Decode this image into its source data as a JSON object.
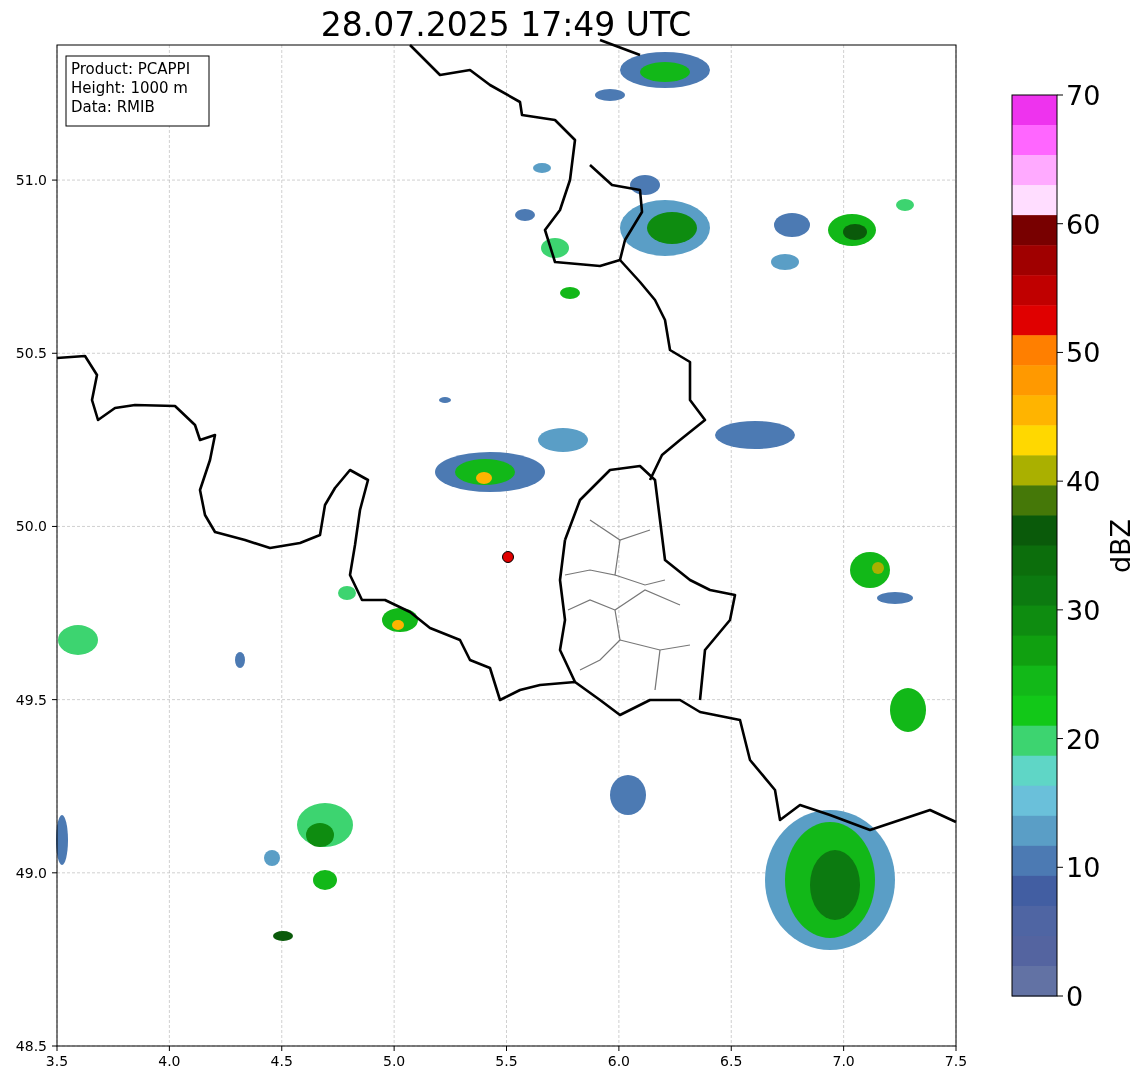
{
  "title": "28.07.2025 17:49 UTC",
  "info_box": [
    "Product: PCAPPI",
    "Height: 1000 m",
    "Data: RMIB"
  ],
  "map": {
    "xticks": [
      "3.5",
      "4.0",
      "4.5",
      "5.0",
      "5.5",
      "6.0",
      "6.5",
      "7.0",
      "7.5"
    ],
    "yticks": [
      "51.0",
      "50.5",
      "50.0",
      "49.5",
      "49.0",
      "48.5"
    ]
  },
  "colorbar": {
    "label": "dBZ",
    "ticks": [
      "70",
      "60",
      "50",
      "40",
      "30",
      "20",
      "10",
      "0"
    ],
    "bands": [
      {
        "color": "#ee33ee"
      },
      {
        "color": "#ff66ff"
      },
      {
        "color": "#ffaaff"
      },
      {
        "color": "#ffddff"
      },
      {
        "color": "#780000"
      },
      {
        "color": "#a00000"
      },
      {
        "color": "#c00000"
      },
      {
        "color": "#e00000"
      },
      {
        "color": "#ff7f00"
      },
      {
        "color": "#ff9900"
      },
      {
        "color": "#ffb400"
      },
      {
        "color": "#ffd800"
      },
      {
        "color": "#aab000"
      },
      {
        "color": "#457808"
      },
      {
        "color": "#0a5a0a"
      },
      {
        "color": "#0c6e0c"
      },
      {
        "color": "#0c7a10"
      },
      {
        "color": "#0e8c10"
      },
      {
        "color": "#10a010"
      },
      {
        "color": "#12b818"
      },
      {
        "color": "#12c818"
      },
      {
        "color": "#3dd470"
      },
      {
        "color": "#5fd6c6"
      },
      {
        "color": "#6ac0da"
      },
      {
        "color": "#5a9ec6"
      },
      {
        "color": "#4c7ab3"
      },
      {
        "color": "#425ea2"
      },
      {
        "color": "#4f65a3"
      },
      {
        "color": "#5464a0"
      },
      {
        "color": "#6272a4"
      }
    ]
  }
}
